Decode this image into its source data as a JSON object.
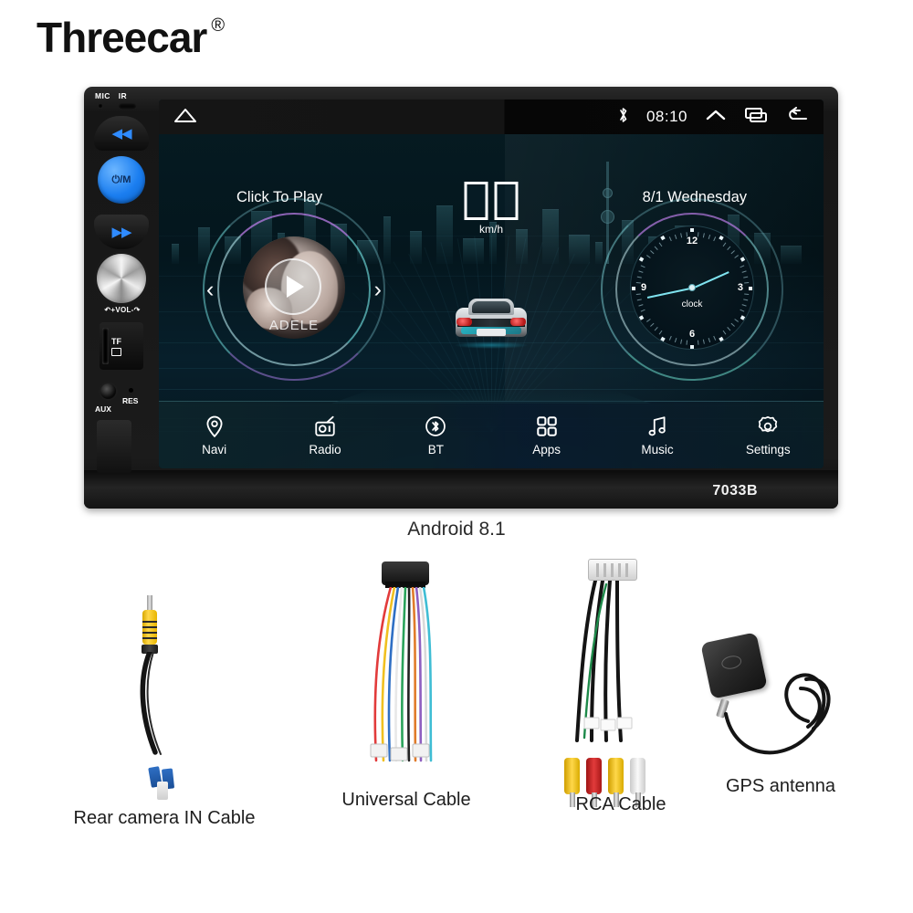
{
  "brand": {
    "name": "Threecar",
    "trademark": "®"
  },
  "device": {
    "model": "7033B",
    "caption": "Android 8.1",
    "left_panel": {
      "mic_label": "MIC",
      "ir_label": "IR",
      "prev_glyph": "⏮",
      "power_label": "⏻/M",
      "next_glyph": "⏭",
      "volume_label": "↶+VOL-↷",
      "tf_label": "TF",
      "aux_label": "AUX",
      "res_label": "RES"
    }
  },
  "screen": {
    "status_bar": {
      "home_icon": "home-icon",
      "bluetooth_icon": "bluetooth-icon",
      "time": "08:10",
      "expand_icon": "chevron-up-icon",
      "recents_icon": "recents-icon",
      "back_icon": "back-icon"
    },
    "music_widget": {
      "title": "Click To Play",
      "artist": "ADELE",
      "prev_chevron": "‹",
      "next_chevron": "›",
      "play_icon": "play-icon"
    },
    "speed_widget": {
      "value": "",
      "unit": "km/h",
      "digit_count": 2
    },
    "date_widget": {
      "text": "8/1 Wednesday"
    },
    "clock_widget": {
      "label": "clock",
      "numerals": [
        "12",
        "3",
        "6",
        "9"
      ]
    },
    "nav_items": [
      {
        "label": "Navi",
        "icon": "map-pin-icon"
      },
      {
        "label": "Radio",
        "icon": "radio-icon"
      },
      {
        "label": "BT",
        "icon": "bluetooth-icon"
      },
      {
        "label": "Apps",
        "icon": "grid-apps-icon"
      },
      {
        "label": "Music",
        "icon": "music-note-icon"
      },
      {
        "label": "Settings",
        "icon": "gear-icon"
      }
    ]
  },
  "accessories": [
    {
      "label": "Rear camera IN Cable",
      "icon": "rca-yellow-cable"
    },
    {
      "label": "Universal Cable",
      "icon": "wire-harness"
    },
    {
      "label": "RCA Cable",
      "icon": "rca-multi-cable"
    },
    {
      "label": "GPS antenna",
      "icon": "gps-antenna"
    }
  ],
  "colors": {
    "accent_blue": "#1b7ef0",
    "screen_cyan": "#7fe3ef",
    "bezel_black": "#161616",
    "rca_yellow": "#ffd84a",
    "rca_red": "#d41f1f",
    "rca_white": "#f0f0f0"
  }
}
